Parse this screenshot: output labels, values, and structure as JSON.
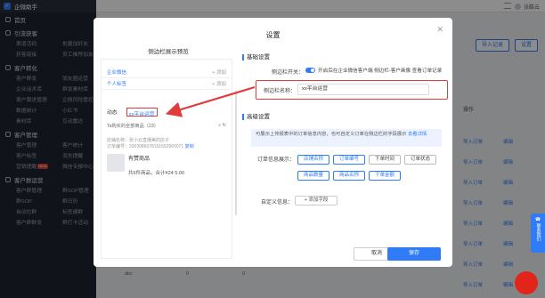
{
  "app": {
    "name": "企微助手",
    "user": "张酷云"
  },
  "sidebar": {
    "sections": [
      {
        "label": "首页",
        "items": []
      },
      {
        "label": "引流获客",
        "items": [
          "渠道活码",
          "批量加好友",
          "获客链接",
          "员工推荐加友"
        ]
      },
      {
        "label": "客户转化",
        "items": [
          "客户群发",
          "朋友圈运营",
          "企业话术库",
          "群发素材库",
          "客户跟进管理",
          "企微风险管控",
          "数据统计",
          "小红书",
          "素材库",
          "互动雷达"
        ]
      },
      {
        "label": "客户管理",
        "items": [
          "客户管理",
          "客户统计",
          "客户标签",
          "流失提醒",
          "营销提醒",
          "微信专报中心"
        ]
      },
      {
        "label": "客户群运营",
        "items": [
          "客户群管理",
          "群SOP管理",
          "群SOP",
          "群日历",
          "自动拉群",
          "标签建群",
          "客户群群发",
          "群打卡活动"
        ]
      }
    ],
    "hot_badge": "NEW"
  },
  "background": {
    "buttons": [
      "导入记录",
      "设置"
    ],
    "col1_header": "操作",
    "col1_rows": [
      "导入订单",
      "导入订单",
      "导入订单",
      "导入订单",
      "导入订单",
      "导入订单",
      "导入订单",
      "导入订单"
    ],
    "col2_rows": [
      "编辑",
      "编辑",
      "编辑",
      "编辑",
      "编辑",
      "编辑",
      "编辑",
      "编辑"
    ],
    "bottom": [
      "abc",
      "0",
      "0"
    ]
  },
  "float": {
    "contact": "联系我们"
  },
  "modal": {
    "title": "设置",
    "preview": {
      "title": "侧边栏展示预览",
      "rows": [
        {
          "left": "企业微信",
          "right": "+ 添加"
        },
        {
          "left": "个人标签",
          "right": "+ 添加"
        }
      ],
      "tabs": [
        "动态",
        "xx平台运营"
      ],
      "search_text": "Ta购买的全部商品（23）",
      "small_lines": [
        "店铺名称：张小云直播美的店子",
        "订单编号：3303086078151592560071"
      ],
      "small_link": "复制",
      "product_name": "有赞商品",
      "product_price": "共6件商品，合计¥24 5.00"
    },
    "basic": {
      "section": "基础设置",
      "sidebar_switch_label": "侧边栏开关：",
      "sidebar_switch_text": "开启后在企业微信客户端 侧边栏-客户画像 查看订单记录",
      "sidebar_name_label": "侧边栏名称：",
      "sidebar_name_value": "xx平台运营"
    },
    "advanced": {
      "section": "高级设置",
      "hint": "可展示上传报表中的订单信息内容，也可自定义订单在侧边栏的字段展示",
      "hint_link": "去看详情",
      "fields_label": "订单信息展示：",
      "chips": [
        {
          "label": "店铺名称",
          "on": true
        },
        {
          "label": "订单编号",
          "on": true
        },
        {
          "label": "下单时间",
          "on": false
        },
        {
          "label": "订单状态",
          "on": false
        },
        {
          "label": "商品数量",
          "on": true
        },
        {
          "label": "商品名称",
          "on": true
        },
        {
          "label": "下单金额",
          "on": true
        }
      ],
      "custom_label": "自定义信息：",
      "add_field": "+ 添加字段"
    },
    "cancel": "取消",
    "save": "保存"
  }
}
